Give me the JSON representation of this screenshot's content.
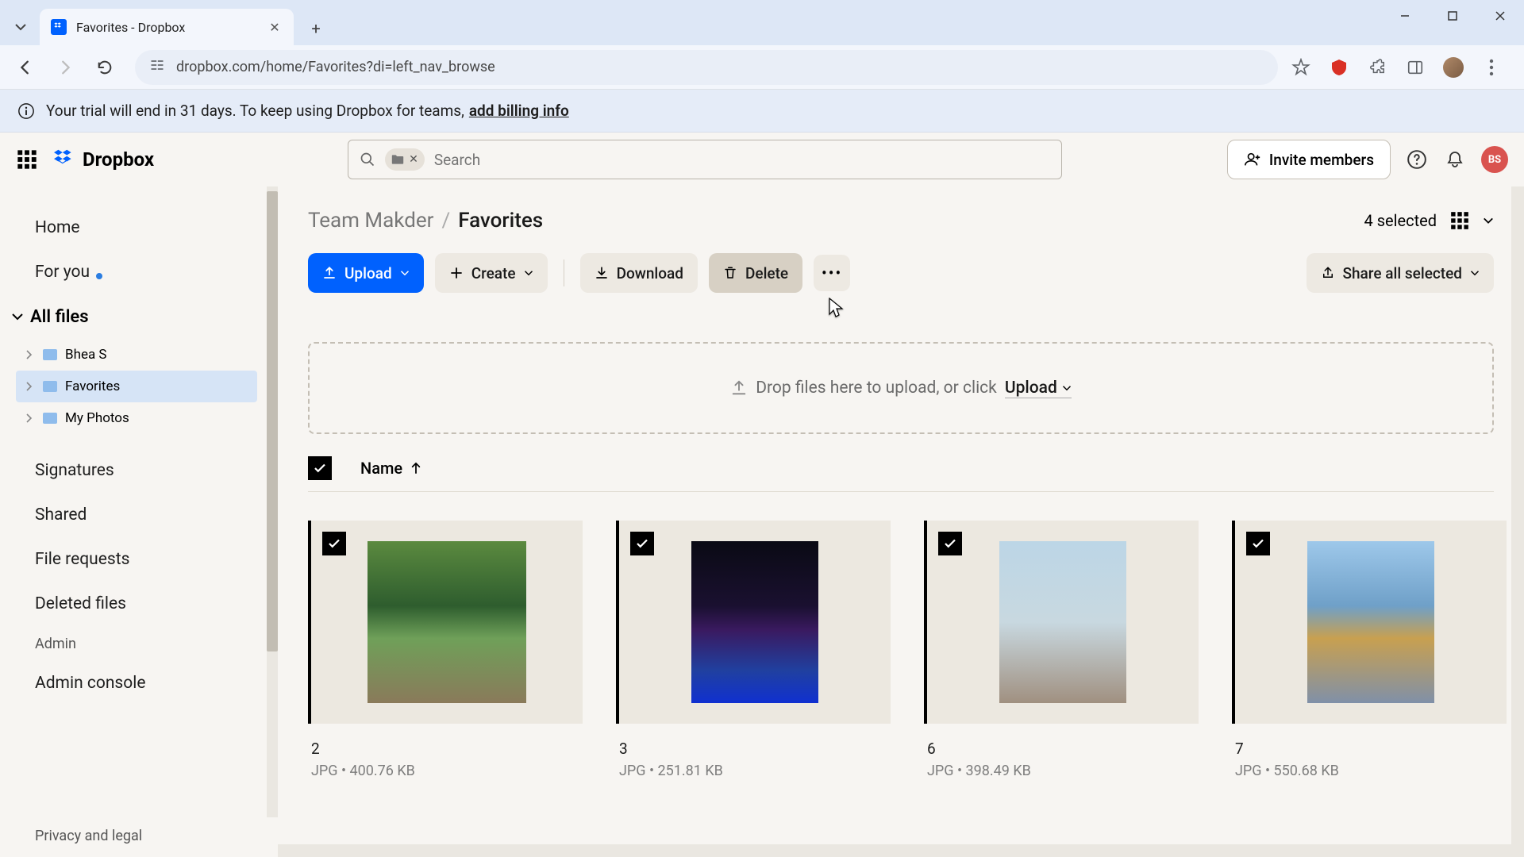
{
  "browser": {
    "tab_title": "Favorites - Dropbox",
    "url": "dropbox.com/home/Favorites?di=left_nav_browse"
  },
  "banner": {
    "text": "Your trial will end in 31 days. To keep using Dropbox for teams,",
    "link": "add billing info"
  },
  "appbar": {
    "brand": "Dropbox",
    "search_placeholder": "Search",
    "invite": "Invite members",
    "user_initials": "BS"
  },
  "sidebar": {
    "home": "Home",
    "for_you": "For you",
    "all_files": "All files",
    "tree": [
      {
        "label": "Bhea S"
      },
      {
        "label": "Favorites"
      },
      {
        "label": "My Photos"
      }
    ],
    "signatures": "Signatures",
    "shared": "Shared",
    "file_requests": "File requests",
    "deleted": "Deleted files",
    "admin": "Admin",
    "admin_console": "Admin console",
    "privacy": "Privacy and legal"
  },
  "breadcrumb": {
    "parent": "Team Makder",
    "current": "Favorites",
    "selected": "4 selected"
  },
  "toolbar": {
    "upload": "Upload",
    "create": "Create",
    "download": "Download",
    "delete": "Delete",
    "share": "Share all selected"
  },
  "dropzone": {
    "text": "Drop files here to upload, or click",
    "upload": "Upload"
  },
  "columns": {
    "name": "Name"
  },
  "files": [
    {
      "name": "2",
      "meta": "JPG • 400.76 KB"
    },
    {
      "name": "3",
      "meta": "JPG • 251.81 KB"
    },
    {
      "name": "6",
      "meta": "JPG • 398.49 KB"
    },
    {
      "name": "7",
      "meta": "JPG • 550.68 KB"
    }
  ]
}
